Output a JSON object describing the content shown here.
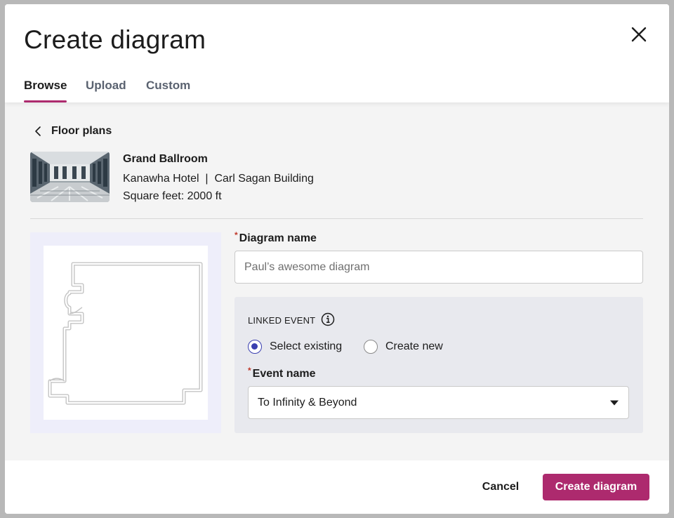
{
  "modal": {
    "title": "Create diagram",
    "close_icon": "close-icon"
  },
  "tabs": [
    {
      "label": "Browse",
      "active": true
    },
    {
      "label": "Upload",
      "active": false
    },
    {
      "label": "Custom",
      "active": false
    }
  ],
  "breadcrumb": {
    "back_icon": "chevron-left-icon",
    "label": "Floor plans"
  },
  "room": {
    "name": "Grand Ballroom",
    "location": "Kanawha Hotel  |  Carl Sagan Building",
    "size": "Square feet: 2000 ft"
  },
  "form": {
    "required_marker": "*",
    "diagram_name_label": "Diagram name",
    "diagram_name_placeholder": "Paul’s awesome diagram",
    "diagram_name_value": "",
    "linked_event": {
      "title": "LINKED EVENT",
      "info_icon": "info-icon",
      "options": [
        {
          "label": "Select existing",
          "selected": true
        },
        {
          "label": "Create new",
          "selected": false
        }
      ],
      "event_name_label": "Event name",
      "event_name_value": "To Infinity & Beyond",
      "dropdown_icon": "caret-down-icon"
    }
  },
  "footer": {
    "cancel_label": "Cancel",
    "create_label": "Create diagram"
  },
  "colors": {
    "accent": "#ad2a6e",
    "radio_selected": "#3a3fb0",
    "required": "#c0392b",
    "body_bg": "#f4f4f4",
    "linked_panel_bg": "#e8e9ee",
    "preview_bg": "#eeeefa"
  }
}
